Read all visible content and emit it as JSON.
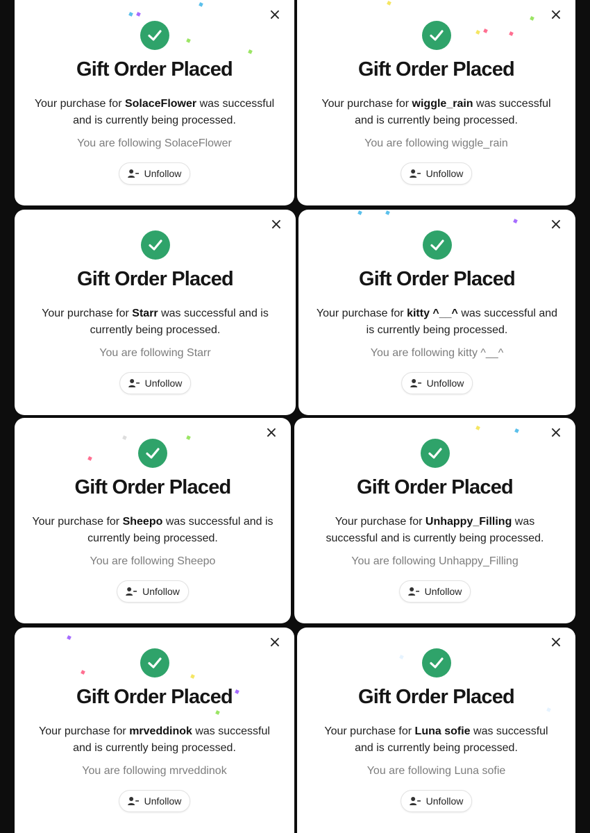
{
  "colors": {
    "success_green": "#2fa36a",
    "background": "#0d0d0d"
  },
  "icons": {
    "check": "check-circle-icon",
    "close": "close-icon",
    "unfollow": "user-minus-icon"
  },
  "cards": [
    {
      "title": "Gift Order Placed",
      "msg_prefix": "Your purchase for ",
      "recipient": "SolaceFlower",
      "msg_suffix": " was successful and is currently being processed.",
      "following": "You are following SolaceFlower",
      "button": "Unfollow",
      "close": "×"
    },
    {
      "title": "Gift Order Placed",
      "msg_prefix": "Your purchase for ",
      "recipient": "wiggle_rain",
      "msg_suffix": " was successful and is currently being processed.",
      "following": "You are following wiggle_rain",
      "button": "Unfollow",
      "close": "×"
    },
    {
      "title": "Gift Order Placed",
      "msg_prefix": "Your purchase for ",
      "recipient": "Starr",
      "msg_suffix": " was successful and is currently being processed.",
      "following": "You are following Starr",
      "button": "Unfollow",
      "close": "×"
    },
    {
      "title": "Gift Order Placed",
      "msg_prefix": "Your purchase for ",
      "recipient": "kitty ^__^",
      "msg_suffix": " was successful and is currently being processed.",
      "following": "You are following kitty ^__^",
      "button": "Unfollow",
      "close": "×"
    },
    {
      "title": "Gift Order Placed",
      "msg_prefix": "Your purchase for ",
      "recipient": "Sheepo",
      "msg_suffix": " was successful and is currently being processed.",
      "following": "You are following Sheepo",
      "button": "Unfollow",
      "close": "×"
    },
    {
      "title": "Gift Order Placed",
      "msg_prefix": "Your purchase for ",
      "recipient": "Unhappy_Filling",
      "msg_suffix": " was successful and is currently being processed.",
      "following": "You are following Unhappy_Filling",
      "button": "Unfollow",
      "close": "×"
    },
    {
      "title": "Gift Order Placed",
      "msg_prefix": "Your purchase for ",
      "recipient": "mrveddinok",
      "msg_suffix": " was successful and is currently being processed.",
      "following": "You are following mrveddinok",
      "button": "Unfollow",
      "close": "×"
    },
    {
      "title": "Gift Order Placed",
      "msg_prefix": "Your purchase for ",
      "recipient": "Luna sofie",
      "msg_suffix": " was successful and is currently being processed.",
      "following": "You are following Luna sofie",
      "button": "Unfollow",
      "close": "×"
    }
  ]
}
